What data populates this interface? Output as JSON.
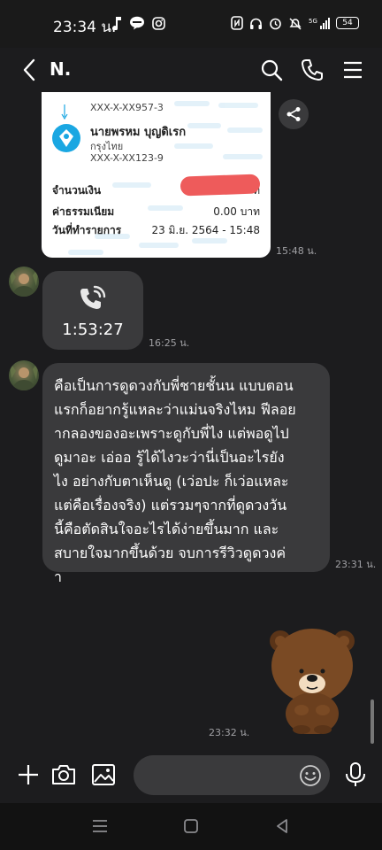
{
  "status_bar": {
    "time": "23:34 น.",
    "battery": "54",
    "network": "5G"
  },
  "header": {
    "contact_name": "N.",
    "back_icon": "chevron-left-icon",
    "search_icon": "search-icon",
    "call_icon": "phone-icon",
    "menu_icon": "hamburger-menu-icon"
  },
  "receipt": {
    "sender_account": "XXX-X-XX957-3",
    "recipient_name": "นายพรหม บุญดิเรก",
    "recipient_bank": "กรุงไทย",
    "recipient_account": "XXX-X-XX123-9",
    "amount_label": "จำนวนเงิน",
    "amount_unit_visible": "ท",
    "fee_label": "ค่าธรรมเนียม",
    "fee_value": "0.00 บาท",
    "date_label": "วันที่ทำรายการ",
    "date_value": "23 มิ.ย. 2564 - 15:48",
    "timestamp": "15:48 น."
  },
  "messages": {
    "call": {
      "duration": "1:53:27",
      "timestamp": "16:25 น."
    },
    "text": {
      "lines": [
        "คือเป็นการดูดวงกับพี่ชายชั้นน แบบตอน",
        "แรกก็อยากรู้แหละว่าแม่นจริงไหม ฟีลอย",
        "ากลองของอะเพราะดูกับพี่ไง แต่พอดูไป",
        "ดูมาอะ เอ่ออ รู้ได้ไงวะว่านี่เป็นอะไรยัง",
        "ไง อย่างกับตาเห็นดู (เว่อปะ ก็เว่อแหละ",
        "แต่คือเรื่องจริง) แต่รวมๆจากที่ดูดวงวัน",
        "นี้คือตัดสินใจอะไรได้ง่ายขึ้นมาก และ",
        "สบายใจมากขึ้นด้วย จบการรีวิวดูดวงค่",
        "า"
      ],
      "timestamp": "23:31 น."
    },
    "sticker": {
      "name": "brown-bear-sticker",
      "timestamp": "23:32 น."
    }
  },
  "input_bar": {
    "placeholder": "",
    "add_icon": "plus-icon",
    "camera_icon": "camera-icon",
    "gallery_icon": "image-icon",
    "emoji_icon": "emoji-icon",
    "mic_icon": "microphone-icon"
  },
  "colors": {
    "background": "#1c1c1e",
    "bubble": "#3a3a3c",
    "timestamp": "#a0a0a4",
    "redaction": "#ee5b5b",
    "bank_logo": "#1aa7e2"
  }
}
